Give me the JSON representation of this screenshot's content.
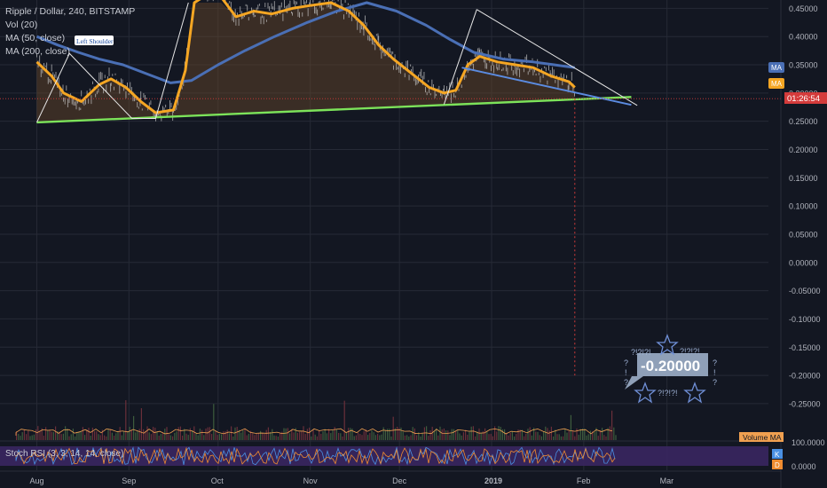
{
  "header": {
    "symbol_line": "Ripple / Dollar, 240, BITSTAMP",
    "indicators": [
      "Vol (20)",
      "MA (50, close)",
      "MA (200, close)"
    ]
  },
  "annotations": {
    "left_shoulder": "Left Shoulder",
    "callout_value": "-0.20000",
    "qmarks_top": "?!?!?!",
    "qmarks_top2": "?!?!?!",
    "qmarks_bottom": "?!?!?!",
    "qmark_left": "?",
    "qmark_left2": "!",
    "qmark_left3": "?",
    "qmark_right": "?",
    "qmark_right2": "!",
    "qmark_right3": "?"
  },
  "price_tags": {
    "ma200": "MA",
    "ma50": "MA",
    "countdown": "01:26:54",
    "volume_ma": "Volume MA"
  },
  "stoch": {
    "label": "Stoch RSI (3, 3, 14, 14, close)",
    "axis": [
      "100.0000",
      "0.0000"
    ],
    "k_tag": "K",
    "d_tag": "D"
  },
  "colors": {
    "background": "#131722",
    "grid": "#262a36",
    "ma50": "#f5a623",
    "ma200": "#4a6fb5",
    "neckline": "#7ce35a",
    "candle": "#c8c8c8",
    "stoch_band": "#5b3b8c",
    "stoch_k": "#4a90e2",
    "stoch_d": "#f08c30",
    "volume_ma": "#f0a050"
  },
  "chart_data": {
    "type": "line",
    "title": "Ripple / Dollar, 240, BITSTAMP",
    "xlabel": "",
    "ylabel": "",
    "x_ticks": [
      "Aug",
      "Sep",
      "Oct",
      "Nov",
      "Dec",
      "2019",
      "Feb",
      "Mar"
    ],
    "y_ticks": [
      "0.45000",
      "0.40000",
      "0.35000",
      "0.30000",
      "0.25000",
      "0.20000",
      "0.15000",
      "0.10000",
      "0.05000",
      "0.00000",
      "-0.05000",
      "-0.10000",
      "-0.15000",
      "-0.20000",
      "-0.25000"
    ],
    "ylim": [
      -0.28,
      0.46
    ],
    "series": [
      {
        "name": "MA (50, close)",
        "points": [
          [
            "2018-08-01",
            0.355
          ],
          [
            "2018-08-06",
            0.33
          ],
          [
            "2018-08-10",
            0.3
          ],
          [
            "2018-08-16",
            0.285
          ],
          [
            "2018-08-22",
            0.315
          ],
          [
            "2018-08-26",
            0.325
          ],
          [
            "2018-08-31",
            0.31
          ],
          [
            "2018-09-05",
            0.285
          ],
          [
            "2018-09-10",
            0.265
          ],
          [
            "2018-09-16",
            0.27
          ],
          [
            "2018-09-20",
            0.34
          ],
          [
            "2018-09-23",
            0.46
          ],
          [
            "2018-09-26",
            0.5
          ],
          [
            "2018-10-02",
            0.49
          ],
          [
            "2018-10-07",
            0.435
          ],
          [
            "2018-10-13",
            0.445
          ],
          [
            "2018-10-19",
            0.44
          ],
          [
            "2018-10-26",
            0.45
          ],
          [
            "2018-11-01",
            0.455
          ],
          [
            "2018-11-08",
            0.46
          ],
          [
            "2018-11-14",
            0.445
          ],
          [
            "2018-11-19",
            0.42
          ],
          [
            "2018-11-24",
            0.385
          ],
          [
            "2018-11-29",
            0.36
          ],
          [
            "2018-12-05",
            0.335
          ],
          [
            "2018-12-11",
            0.31
          ],
          [
            "2018-12-16",
            0.3
          ],
          [
            "2018-12-20",
            0.305
          ],
          [
            "2018-12-24",
            0.35
          ],
          [
            "2018-12-28",
            0.365
          ],
          [
            "2019-01-03",
            0.355
          ],
          [
            "2019-01-09",
            0.35
          ],
          [
            "2019-01-15",
            0.345
          ],
          [
            "2019-01-21",
            0.33
          ],
          [
            "2019-01-27",
            0.32
          ],
          [
            "2019-01-29",
            0.31
          ]
        ]
      },
      {
        "name": "MA (200, close)",
        "points": [
          [
            "2018-08-01",
            0.4
          ],
          [
            "2018-08-08",
            0.385
          ],
          [
            "2018-08-15",
            0.372
          ],
          [
            "2018-08-22",
            0.36
          ],
          [
            "2018-08-30",
            0.35
          ],
          [
            "2018-09-08",
            0.332
          ],
          [
            "2018-09-15",
            0.318
          ],
          [
            "2018-09-22",
            0.322
          ],
          [
            "2018-10-01",
            0.35
          ],
          [
            "2018-10-10",
            0.375
          ],
          [
            "2018-10-20",
            0.4
          ],
          [
            "2018-10-31",
            0.425
          ],
          [
            "2018-11-10",
            0.445
          ],
          [
            "2018-11-20",
            0.46
          ],
          [
            "2018-11-30",
            0.445
          ],
          [
            "2018-12-10",
            0.42
          ],
          [
            "2018-12-18",
            0.395
          ],
          [
            "2018-12-26",
            0.372
          ],
          [
            "2019-01-05",
            0.36
          ],
          [
            "2019-01-15",
            0.355
          ],
          [
            "2019-01-22",
            0.35
          ],
          [
            "2019-01-29",
            0.345
          ]
        ]
      }
    ],
    "trendlines": [
      {
        "name": "neckline",
        "from": [
          "2018-08-01",
          0.248
        ],
        "to": [
          "2019-02-17",
          0.293
        ]
      },
      {
        "name": "wedge-upper",
        "from": [
          "2018-12-27",
          0.448
        ],
        "to": [
          "2019-02-19",
          0.278
        ]
      },
      {
        "name": "wedge-lower",
        "from": [
          "2018-12-22",
          0.345
        ],
        "to": [
          "2019-02-17",
          0.279
        ]
      }
    ],
    "projection": {
      "from": [
        "2019-01-29",
        0.29
      ],
      "to": [
        "2019-01-29",
        -0.2
      ]
    },
    "current_price_line": 0.29
  }
}
